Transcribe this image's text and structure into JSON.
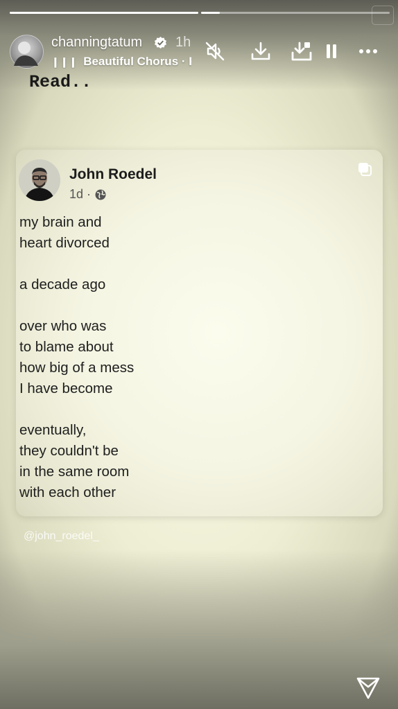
{
  "story": {
    "username": "channingtatum",
    "time_ago": "1h",
    "music_track": "Beautiful Chorus · Fa",
    "progress_segments": [
      1.0,
      0.1
    ]
  },
  "icons": {
    "verified": "verified-badge-icon",
    "mute": "speaker-muted-icon",
    "download": "download-icon",
    "save": "save-to-icon",
    "pause": "pause-icon",
    "more": "more-dots-icon",
    "send": "send-icon",
    "copy": "copy-icon",
    "globe": "globe-icon"
  },
  "caption": "Read..",
  "post": {
    "author": "John Roedel",
    "age": "1d ·",
    "lines": [
      "my brain and",
      "heart divorced",
      "",
      "a decade ago",
      "",
      "over who was",
      "to blame about",
      "how big of a mess",
      "I have become",
      "",
      "eventually,",
      "they couldn't be",
      "in the same room",
      "with each other"
    ]
  },
  "handle": "@john_roedel_"
}
